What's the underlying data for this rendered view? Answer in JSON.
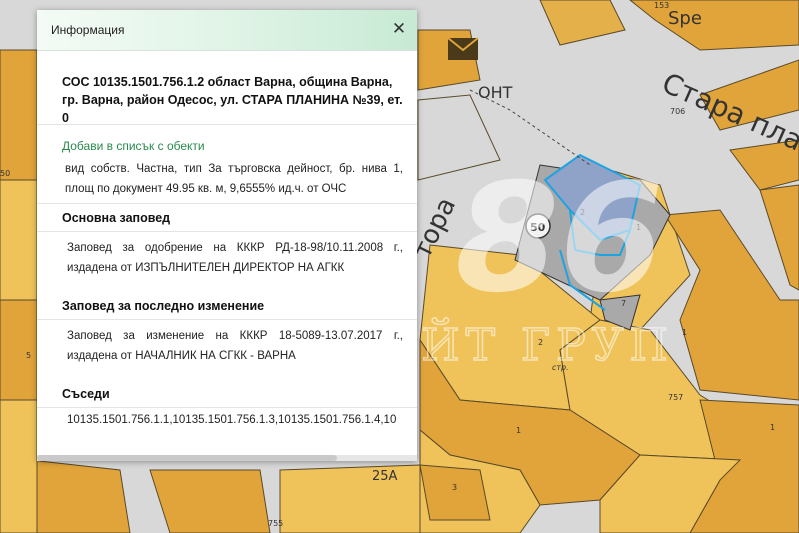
{
  "panel": {
    "title": "Информация",
    "close_label": "✕",
    "heading": "СОС 10135.1501.756.1.2 област Варна, община Варна, гр. Варна, район Одесос, ул. СТАРА ПЛАНИНА №39, ет. 0",
    "add_link": "Добави в списък с обекти",
    "description": "вид собств. Частна, тип За търговска дейност, бр. нива 1, площ по документ 49.95 кв. м, 9,6555% ид.ч. от ОЧС",
    "main_order_title": "Основна заповед",
    "main_order_text": "Заповед за одобрение на КККР РД-18-98/10.11.2008 г., издадена от ИЗПЪЛНИТЕЛЕН ДИРЕКТОР НА АГКК",
    "last_change_title": "Заповед за последно изменение",
    "last_change_text": "Заповед за изменение на КККР 18-5089-13.07.2017 г., издадена от НАЧАЛНИК НА СГКК - ВАРНА",
    "neighbors_title": "Съседи",
    "neighbors_text": "10135.1501.756.1.1,10135.1501.756.1.3,10135.1501.756.1.4,10"
  },
  "map": {
    "street_upper": "Стара пла",
    "street_left": "тора",
    "shop_label": "ОНТ",
    "shop_prefix": "Spe",
    "labels": {
      "n153": "153",
      "n706": "706",
      "n50": "50",
      "n5": "5",
      "n1a": "1",
      "n1b": "1",
      "n1c": "1",
      "n1d": "1",
      "n2": "2",
      "n2b": "2",
      "n7": "7",
      "n757": "757",
      "n755": "755",
      "n25a": "25А",
      "n3": "3",
      "stp": "стр.",
      "badge": "50"
    },
    "watermark": "86",
    "watermark_sub": "ЕСТЕЙТ ГРУП"
  },
  "colors": {
    "parcel": "#e0a43a",
    "parcel_light": "#f0c35a",
    "street": "#d9d9d9",
    "building_grey": "#a9a9a9",
    "selected_blue": "#1fa3e0",
    "accent_green": "#2a8a4d"
  }
}
